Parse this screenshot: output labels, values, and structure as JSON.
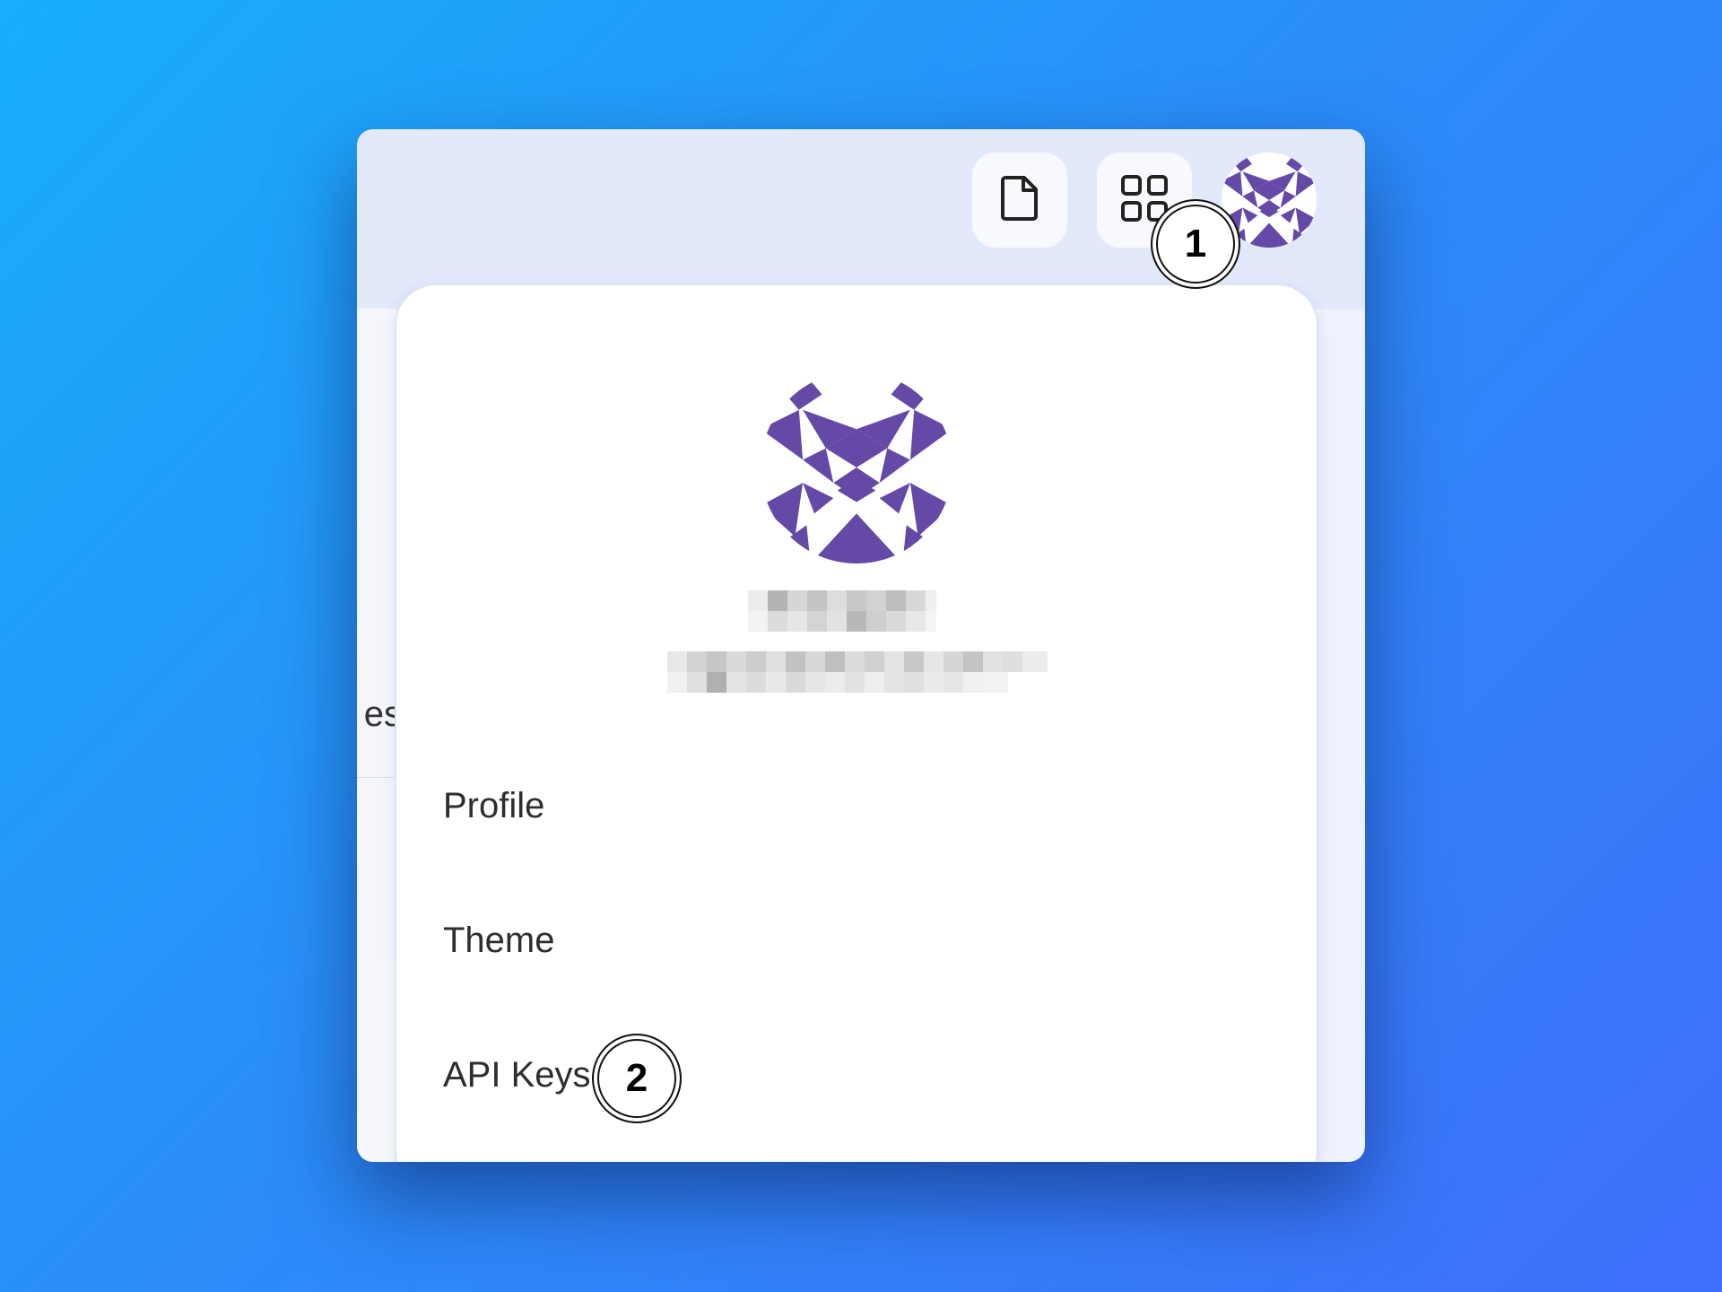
{
  "toolbar": {
    "file_button_icon": "file-icon",
    "apps_button_icon": "grid-icon",
    "avatar_icon": "identicon-avatar"
  },
  "background": {
    "partial_text": "es"
  },
  "profile_menu": {
    "avatar_icon": "identicon-avatar",
    "items": [
      {
        "label": "Profile"
      },
      {
        "label": "Theme"
      },
      {
        "label": "API Keys"
      }
    ]
  },
  "annotations": {
    "marker_1": "1",
    "marker_2": "2"
  },
  "colors": {
    "avatar_purple": "#6549a6",
    "topbar": "#e1e9fb",
    "background_gradient_start": "#18aefc",
    "background_gradient_end": "#3f6ffb"
  }
}
